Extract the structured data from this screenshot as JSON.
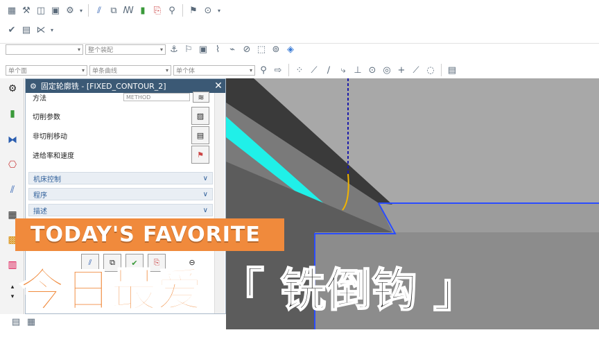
{
  "toolbar": {
    "row1_icons": [
      "create-program-icon",
      "create-tool-icon",
      "create-geometry-icon",
      "create-method-icon",
      "create-operation-icon"
    ],
    "row1b_icons": [
      "generate-path-icon",
      "replay-icon",
      "verify-icon",
      "simulate-icon",
      "postprocess-icon"
    ],
    "row1c_icons": [
      "shop-doc-icon",
      "output-cls-icon"
    ],
    "row2_icons": [
      "feature-icon",
      "table-icon",
      "measure-icon"
    ]
  },
  "selection_bar": {
    "filter_value": "",
    "scope_value": "整个装配"
  },
  "snap_bar": {
    "face_rule": "单个面",
    "curve_rule": "单条曲线",
    "body_rule": "单个体"
  },
  "dialog": {
    "title": "固定轮廓铣 - [FIXED_CONTOUR_2]",
    "method_label": "方法",
    "method_value": "METHOD",
    "cut_params": "切削参数",
    "non_cut_moves": "非切削移动",
    "feeds_speeds": "进给率和速度",
    "sections": [
      "机床控制",
      "程序",
      "描述"
    ]
  },
  "banner": {
    "english": "TODAY'S FAVORITE",
    "cn_part1": "今日最爱",
    "cn_part2": "「 铣倒钩 」"
  },
  "colors": {
    "dialog_title_bg": "#3b5975",
    "banner_orange": "#f08a3c",
    "toolpath_cyan": "#20f0e8",
    "edge_blue": "#2a4cff"
  }
}
